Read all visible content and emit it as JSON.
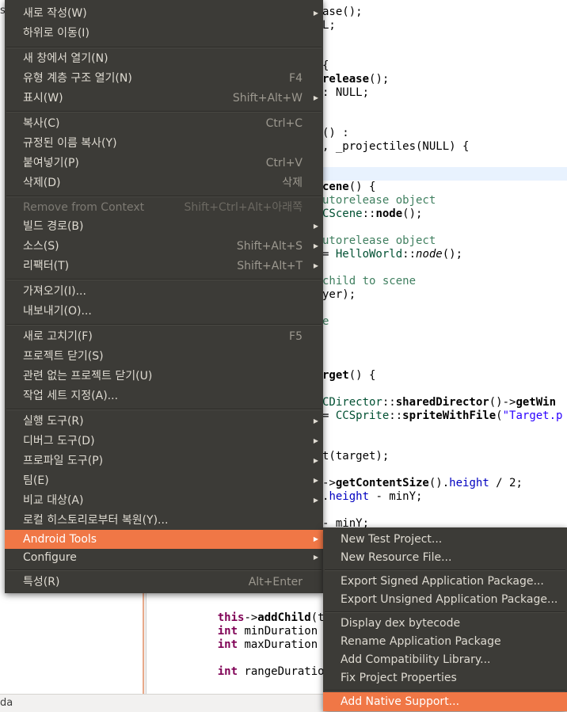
{
  "left_pane": {
    "stub_text": "s"
  },
  "editor": {
    "lines": [
      {
        "t": 7,
        "segs": [
          [
            "",
            "ase();"
          ]
        ]
      },
      {
        "t": 24,
        "segs": [
          [
            "",
            "L;"
          ]
        ]
      },
      {
        "t": 75,
        "segs": [
          [
            "",
            "{"
          ]
        ]
      },
      {
        "t": 92,
        "segs": [
          [
            "fn",
            "release"
          ],
          [
            "",
            "();"
          ]
        ]
      },
      {
        "t": 109,
        "segs": [
          [
            "",
            ": NULL;"
          ]
        ]
      },
      {
        "t": 160,
        "segs": [
          [
            "",
            "() :"
          ]
        ]
      },
      {
        "t": 177,
        "segs": [
          [
            "",
            ", _projectiles(NULL) {"
          ]
        ]
      },
      {
        "t": 228,
        "segs": [
          [
            "fn",
            "cene"
          ],
          [
            "",
            "() {"
          ]
        ]
      },
      {
        "t": 245,
        "segs": [
          [
            "cm",
            "utorelease object"
          ]
        ]
      },
      {
        "t": 262,
        "segs": [
          [
            "ty",
            "CScene"
          ],
          [
            "",
            "::"
          ],
          [
            "fn",
            "node"
          ],
          [
            "",
            "();"
          ]
        ]
      },
      {
        "t": 296,
        "segs": [
          [
            "cm",
            "utorelease object"
          ]
        ]
      },
      {
        "t": 313,
        "segs": [
          [
            "",
            "= "
          ],
          [
            "ty",
            "HelloWorld"
          ],
          [
            "",
            "::"
          ],
          [
            "it",
            "node"
          ],
          [
            "",
            "();"
          ]
        ]
      },
      {
        "t": 347,
        "segs": [
          [
            "cm",
            "child to scene"
          ]
        ]
      },
      {
        "t": 364,
        "segs": [
          [
            "",
            "yer);"
          ]
        ]
      },
      {
        "t": 398,
        "segs": [
          [
            "cm",
            "e"
          ]
        ]
      },
      {
        "t": 466,
        "segs": [
          [
            "fn",
            "rget"
          ],
          [
            "",
            "() {"
          ]
        ]
      },
      {
        "t": 500,
        "segs": [
          [
            "ty",
            "CDirector"
          ],
          [
            "",
            "::"
          ],
          [
            "fn",
            "sharedDirector"
          ],
          [
            "",
            "()->"
          ],
          [
            "fn",
            "getWin"
          ]
        ]
      },
      {
        "t": 517,
        "segs": [
          [
            "",
            "= "
          ],
          [
            "ty",
            "CCSprite"
          ],
          [
            "",
            "::"
          ],
          [
            "fn",
            "spriteWithFile"
          ],
          [
            "",
            "("
          ],
          [
            "str",
            "\"Target.p"
          ]
        ]
      },
      {
        "t": 568,
        "segs": [
          [
            "",
            "t(target);"
          ]
        ]
      },
      {
        "t": 602,
        "segs": [
          [
            "",
            "->"
          ],
          [
            "fn",
            "getContentSize"
          ],
          [
            "",
            "()."
          ],
          [
            "mem",
            "height"
          ],
          [
            "",
            " / 2;"
          ]
        ]
      },
      {
        "t": 619,
        "segs": [
          [
            "",
            "."
          ],
          [
            "mem",
            "height"
          ],
          [
            "",
            " - minY;"
          ]
        ]
      },
      {
        "t": 653,
        "segs": [
          [
            "",
            "- minY;"
          ]
        ]
      },
      {
        "t": 738,
        "segs": [
          [
            "",
            "("
          ]
        ]
      },
      {
        "t": 772,
        "segs": [
          [
            "",
            "    "
          ],
          [
            "kw",
            "this"
          ],
          [
            "",
            "->"
          ],
          [
            "fn",
            "addChild"
          ],
          [
            "",
            "(tar"
          ]
        ]
      },
      {
        "t": 789,
        "segs": [
          [
            "",
            "    "
          ],
          [
            "kw",
            "int"
          ],
          [
            "",
            " minDuration ="
          ]
        ]
      },
      {
        "t": 806,
        "segs": [
          [
            "",
            "    "
          ],
          [
            "kw",
            "int"
          ],
          [
            "",
            " maxDuration ="
          ]
        ]
      },
      {
        "t": 840,
        "segs": [
          [
            "",
            "    "
          ],
          [
            "kw",
            "int"
          ],
          [
            "",
            " rangeDuration"
          ]
        ]
      }
    ]
  },
  "status_bar": {
    "text": "da"
  },
  "context_menu": {
    "items": [
      {
        "label": "새로 작성(W)",
        "accel": "",
        "submenu": true,
        "t": 5
      },
      {
        "label": "하위로 이동(I)",
        "accel": "",
        "submenu": false,
        "t": 30
      },
      {
        "sep": true,
        "t": 59
      },
      {
        "label": "새 창에서 열기(N)",
        "accel": "",
        "submenu": false,
        "t": 62
      },
      {
        "label": "유형 계층 구조 열기(N)",
        "accel": "F4",
        "submenu": false,
        "t": 87
      },
      {
        "label": "표시(W)",
        "accel": "Shift+Alt+W",
        "submenu": true,
        "t": 112
      },
      {
        "sep": true,
        "t": 140
      },
      {
        "label": "복사(C)",
        "accel": "Ctrl+C",
        "submenu": false,
        "t": 144
      },
      {
        "label": "규정된 이름 복사(Y)",
        "accel": "",
        "submenu": false,
        "t": 169
      },
      {
        "label": "붙여넣기(P)",
        "accel": "Ctrl+V",
        "submenu": false,
        "t": 194
      },
      {
        "label": "삭제(D)",
        "accel": "삭제",
        "submenu": false,
        "t": 219
      },
      {
        "sep": true,
        "t": 247
      },
      {
        "label": "Remove from Context",
        "accel": "Shift+Ctrl+Alt+아래쪽",
        "submenu": false,
        "disabled": true,
        "t": 250
      },
      {
        "label": "빌드 경로(B)",
        "accel": "",
        "submenu": true,
        "t": 274
      },
      {
        "label": "소스(S)",
        "accel": "Shift+Alt+S",
        "submenu": true,
        "t": 299
      },
      {
        "label": "리팩터(T)",
        "accel": "Shift+Alt+T",
        "submenu": true,
        "t": 324
      },
      {
        "sep": true,
        "t": 352
      },
      {
        "label": "가져오기(I)...",
        "accel": "",
        "submenu": false,
        "t": 356
      },
      {
        "label": "내보내기(O)...",
        "accel": "",
        "submenu": false,
        "t": 381
      },
      {
        "sep": true,
        "t": 409
      },
      {
        "label": "새로 고치기(F)",
        "accel": "F5",
        "submenu": false,
        "t": 413
      },
      {
        "label": "프로젝트 닫기(S)",
        "accel": "",
        "submenu": false,
        "t": 438
      },
      {
        "label": "관련 없는 프로젝트 닫기(U)",
        "accel": "",
        "submenu": false,
        "t": 463
      },
      {
        "label": "작업 세트 지정(A)...",
        "accel": "",
        "submenu": false,
        "t": 488
      },
      {
        "sep": true,
        "t": 516
      },
      {
        "label": "실행 도구(R)",
        "accel": "",
        "submenu": true,
        "t": 520
      },
      {
        "label": "디버그 도구(D)",
        "accel": "",
        "submenu": true,
        "t": 545
      },
      {
        "label": "프로파일 도구(P)",
        "accel": "",
        "submenu": true,
        "t": 570
      },
      {
        "label": "팀(E)",
        "accel": "",
        "submenu": true,
        "t": 595
      },
      {
        "label": "비교 대상(A)",
        "accel": "",
        "submenu": true,
        "t": 620
      },
      {
        "label": "로컬 히스토리로부터 복원(Y)...",
        "accel": "",
        "submenu": false,
        "t": 645
      },
      {
        "label": "Android Tools",
        "accel": "",
        "submenu": true,
        "active": true,
        "t": 669
      },
      {
        "label": "Configure",
        "accel": "",
        "submenu": true,
        "t": 692
      },
      {
        "sep": true,
        "t": 719
      },
      {
        "label": "특성(R)",
        "accel": "Alt+Enter",
        "submenu": false,
        "t": 723
      }
    ]
  },
  "submenu": {
    "items": [
      {
        "label": "New Test Project...",
        "t": 3
      },
      {
        "label": "New Resource File...",
        "t": 26
      },
      {
        "sep": true,
        "t": 53
      },
      {
        "label": "Export Signed Application Package...",
        "t": 56
      },
      {
        "label": "Export Unsigned Application Package...",
        "t": 79
      },
      {
        "sep": true,
        "t": 106
      },
      {
        "label": "Display dex bytecode",
        "t": 109
      },
      {
        "label": "Rename Application Package",
        "t": 132
      },
      {
        "label": "Add Compatibility Library...",
        "t": 155
      },
      {
        "label": "Fix Project Properties",
        "t": 178
      },
      {
        "sep": true,
        "t": 205
      },
      {
        "label": "Add Native Support...",
        "active": true,
        "t": 208
      }
    ]
  },
  "colors": {
    "menu_bg": "#3c3b37",
    "menu_text": "#dfdbd2",
    "highlight": "#f07746"
  },
  "icons": {
    "submenu_arrow": "submenu-arrow-icon"
  }
}
